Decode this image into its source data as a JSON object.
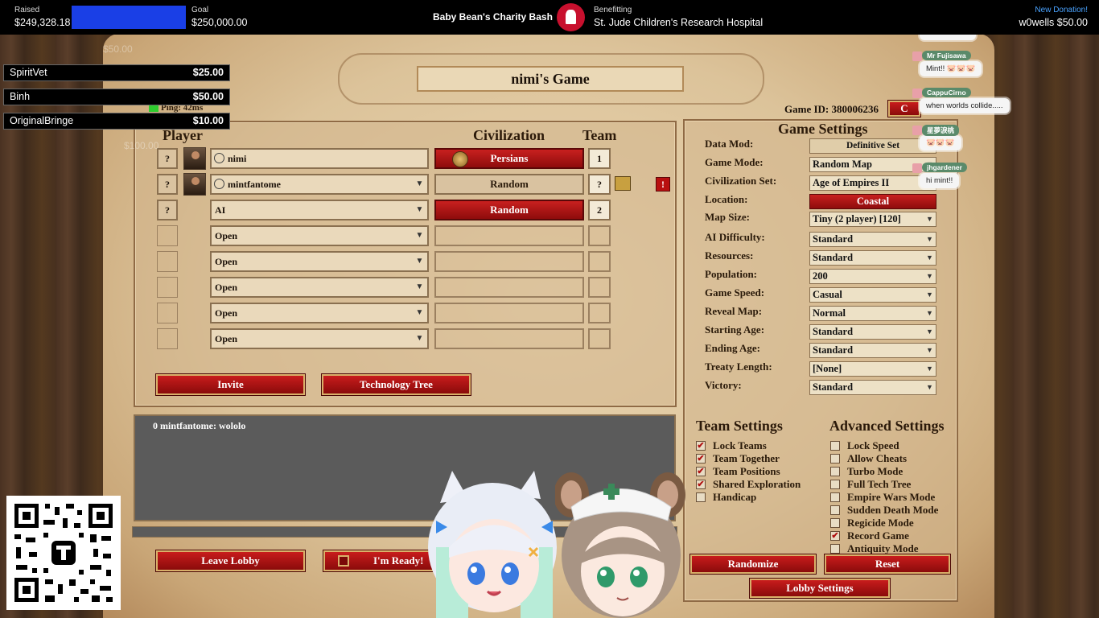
{
  "stream_bar": {
    "raised_label": "Raised",
    "raised_value": "$249,328.18",
    "progress_fraction": 0.997,
    "goal_label": "Goal",
    "goal_value": "$250,000.00",
    "event_title": "Baby Bean's Charity Bash",
    "benefitting_label": "Benefitting",
    "benefitting_value": "St. Jude Children's Research Hospital",
    "new_donation_label": "New Donation!",
    "new_donation_value": "w0wells $50.00"
  },
  "donations": [
    {
      "name": "SpiritVet",
      "amount": "$25.00"
    },
    {
      "name": "Binh",
      "amount": "$50.00"
    },
    {
      "name": "OriginalBringe",
      "amount": "$10.00"
    }
  ],
  "faded_donations": [
    "$50.00",
    "$100.00"
  ],
  "ping_text": "Ping: 42ms",
  "lobby": {
    "title": "nimi's Game",
    "game_id": "Game ID: 380006236",
    "header_player": "Player",
    "header_civ": "Civilization",
    "header_team": "Team",
    "players": [
      {
        "q": "?",
        "name": "nimi",
        "civ": "Persians",
        "team": "1"
      },
      {
        "q": "?",
        "name": "mintfantome",
        "civ": "Random",
        "team": "?"
      },
      {
        "q": "?",
        "name": "AI",
        "civ": "Random",
        "team": "2"
      },
      {
        "q": "",
        "name": "Open",
        "civ": "",
        "team": ""
      },
      {
        "q": "",
        "name": "Open",
        "civ": "",
        "team": ""
      },
      {
        "q": "",
        "name": "Open",
        "civ": "",
        "team": ""
      },
      {
        "q": "",
        "name": "Open",
        "civ": "",
        "team": ""
      },
      {
        "q": "",
        "name": "Open",
        "civ": "",
        "team": ""
      }
    ],
    "invite_label": "Invite",
    "tech_tree_label": "Technology Tree",
    "chat_line": "0 mintfantome: wololo",
    "leave_label": "Leave Lobby",
    "ready_label": "I'm Ready!",
    "warning_symbol": "!"
  },
  "game_settings": {
    "title": "Game Settings",
    "rows": [
      {
        "label": "Data Mod:",
        "value": "Definitive Set"
      },
      {
        "label": "Game Mode:",
        "value": "Random Map"
      },
      {
        "label": "Civilization Set:",
        "value": "Age of Empires II"
      },
      {
        "label": "Location:",
        "value": "Coastal"
      },
      {
        "label": "Map Size:",
        "value": "Tiny (2 player) [120]"
      },
      {
        "label": "AI Difficulty:",
        "value": "Standard"
      },
      {
        "label": "Resources:",
        "value": "Standard"
      },
      {
        "label": "Population:",
        "value": "200"
      },
      {
        "label": "Game Speed:",
        "value": "Casual"
      },
      {
        "label": "Reveal Map:",
        "value": "Normal"
      },
      {
        "label": "Starting Age:",
        "value": "Standard"
      },
      {
        "label": "Ending Age:",
        "value": "Standard"
      },
      {
        "label": "Treaty Length:",
        "value": "[None]"
      },
      {
        "label": "Victory:",
        "value": "Standard"
      }
    ]
  },
  "team_settings": {
    "title": "Team Settings",
    "items": [
      {
        "label": "Lock Teams",
        "checked": true
      },
      {
        "label": "Team Together",
        "checked": true
      },
      {
        "label": "Team Positions",
        "checked": true
      },
      {
        "label": "Shared Exploration",
        "checked": true
      },
      {
        "label": "Handicap",
        "checked": false
      }
    ]
  },
  "advanced_settings": {
    "title": "Advanced Settings",
    "items": [
      {
        "label": "Lock Speed",
        "checked": false
      },
      {
        "label": "Allow Cheats",
        "checked": false
      },
      {
        "label": "Turbo Mode",
        "checked": false
      },
      {
        "label": "Full Tech Tree",
        "checked": false
      },
      {
        "label": "Empire Wars Mode",
        "checked": false
      },
      {
        "label": "Sudden Death Mode",
        "checked": false
      },
      {
        "label": "Regicide Mode",
        "checked": false
      },
      {
        "label": "Record Game",
        "checked": true
      },
      {
        "label": "Antiquity Mode",
        "checked": false
      }
    ]
  },
  "bottom_buttons": {
    "randomize": "Randomize",
    "reset": "Reset",
    "lobby_settings": "Lobby Settings"
  },
  "stream_chat": [
    {
      "name": "Mr Fujisawa",
      "text": "Mint!! 🐷🐷🐷"
    },
    {
      "name": "CappuCirno",
      "text": "when worlds collide....."
    },
    {
      "name": "星夢淚桃",
      "text": "🐷🐷🐷"
    },
    {
      "name": "jhgardener",
      "text": "hi mint!!"
    }
  ],
  "colors": {
    "progress_fill": "#1a3fe6",
    "button_red": "#a81414",
    "check_red": "#b01010"
  }
}
